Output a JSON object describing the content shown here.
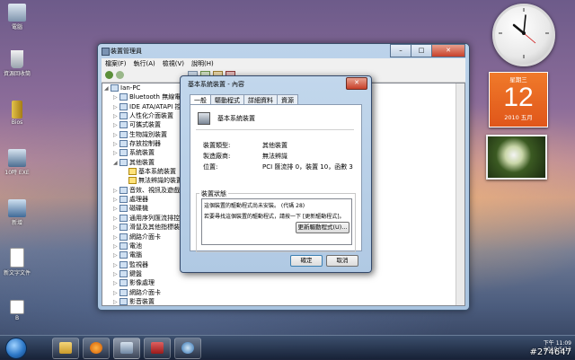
{
  "desktop": {
    "icons": [
      {
        "label": "電腦"
      },
      {
        "label": "資源回收筒"
      },
      {
        "label": "Bios"
      },
      {
        "label": "10時 EXE"
      },
      {
        "label": "新增"
      },
      {
        "label": "新文字文件"
      },
      {
        "label": "B"
      }
    ]
  },
  "gadgets": {
    "calendar": {
      "weekday": "星期三",
      "day": "12",
      "month": "2010 五月"
    }
  },
  "device_manager": {
    "title": "裝置管理員",
    "menu": [
      "檔案(F)",
      "執行(A)",
      "檢視(V)",
      "說明(H)"
    ],
    "tree": [
      {
        "label": "Ian-PC",
        "level": 0,
        "expanded": true
      },
      {
        "label": "Bluetooth 無線電",
        "level": 1
      },
      {
        "label": "IDE ATA/ATAPI 控制器",
        "level": 1
      },
      {
        "label": "人性化介面裝置",
        "level": 1
      },
      {
        "label": "可攜式裝置",
        "level": 1
      },
      {
        "label": "生物識別裝置",
        "level": 1
      },
      {
        "label": "存放控制器",
        "level": 1
      },
      {
        "label": "系統裝置",
        "level": 1
      },
      {
        "label": "其他裝置",
        "level": 1,
        "expanded": true
      },
      {
        "label": "基本系統裝置",
        "level": 2
      },
      {
        "label": "無法辨識的裝置",
        "level": 2
      },
      {
        "label": "音效、視訊及遊戲控制器",
        "level": 1
      },
      {
        "label": "處理器",
        "level": 1
      },
      {
        "label": "磁碟機",
        "level": 1
      },
      {
        "label": "通用序列匯流排控制器",
        "level": 1
      },
      {
        "label": "滑鼠及其他指標裝置",
        "level": 1
      },
      {
        "label": "網路介面卡",
        "level": 1
      },
      {
        "label": "電池",
        "level": 1
      },
      {
        "label": "電腦",
        "level": 1
      },
      {
        "label": "監視器",
        "level": 1
      },
      {
        "label": "鍵盤",
        "level": 1
      },
      {
        "label": "影像處理",
        "level": 1
      },
      {
        "label": "網路介面卡",
        "level": 1
      },
      {
        "label": "影音裝置",
        "level": 1
      },
      {
        "label": "處理器",
        "level": 1
      },
      {
        "label": "顯示卡",
        "level": 1
      },
      {
        "label": "磁碟機",
        "level": 1
      }
    ]
  },
  "properties": {
    "title": "基本系統裝置 - 內容",
    "tabs": [
      "一般",
      "驅動程式",
      "詳細資料",
      "資源"
    ],
    "device_name": "基本系統裝置",
    "fields": [
      {
        "label": "裝置類型:",
        "value": "其他裝置"
      },
      {
        "label": "製造廠商:",
        "value": "無法辨識"
      },
      {
        "label": "位置:",
        "value": "PCI 匯流排 0，裝置 10，函數 3"
      }
    ],
    "status_group": "裝置狀態",
    "status_line1": "這個裝置的驅動程式尚未安裝。 (代碼 28)",
    "status_line2": "若要尋找這個裝置的驅動程式，請按一下 [更新驅動程式]。",
    "update_button": "更新驅動程式(U)...",
    "ok_button": "確定",
    "cancel_button": "取消"
  },
  "taskbar": {
    "time": "下午 11:09",
    "date": "2010/5/12",
    "watermark": "#274647"
  }
}
